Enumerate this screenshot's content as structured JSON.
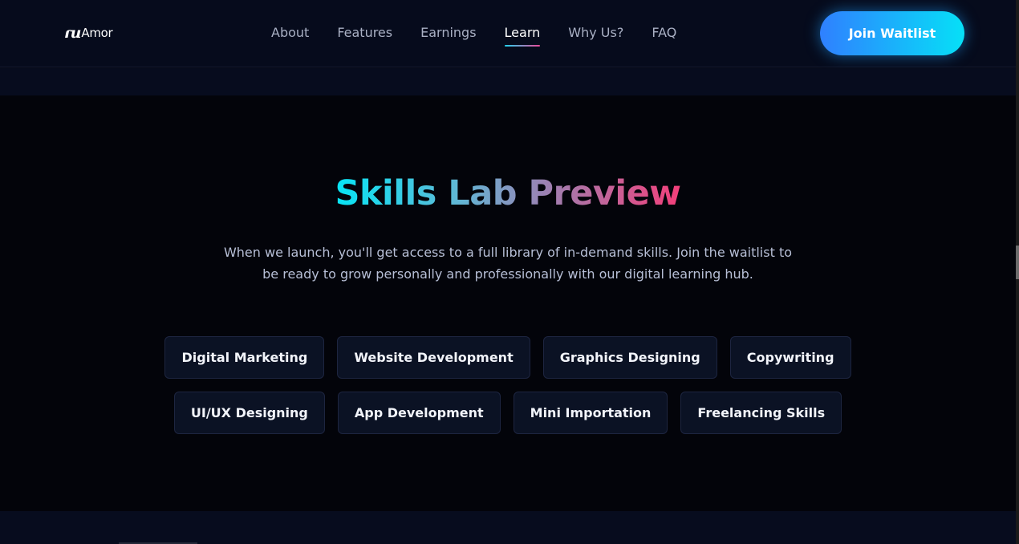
{
  "brand": {
    "mark": "ɾu",
    "name": "Amor"
  },
  "nav": {
    "links": [
      "About",
      "Features",
      "Earnings",
      "Learn",
      "Why Us?",
      "FAQ"
    ],
    "active": "Learn"
  },
  "cta": {
    "label": "Join Waitlist"
  },
  "section": {
    "title": "Skills Lab Preview",
    "description": "When we launch, you'll get access to a full library of in-demand skills. Join the waitlist to be ready to grow personally and professionally with our digital learning hub.",
    "skills_row1": [
      "Digital Marketing",
      "Website Development",
      "Graphics Designing",
      "Copywriting"
    ],
    "skills_row2": [
      "UI/UX Designing",
      "App Development",
      "Mini Importation",
      "Freelancing Skills"
    ]
  },
  "colors": {
    "background": "#050816",
    "cta_gradient_start": "#2f80ff",
    "cta_gradient_end": "#06e0f7",
    "title_gradient_start": "#06e5f5",
    "title_gradient_end": "#f43f7a",
    "chip_background": "#0b1224"
  }
}
